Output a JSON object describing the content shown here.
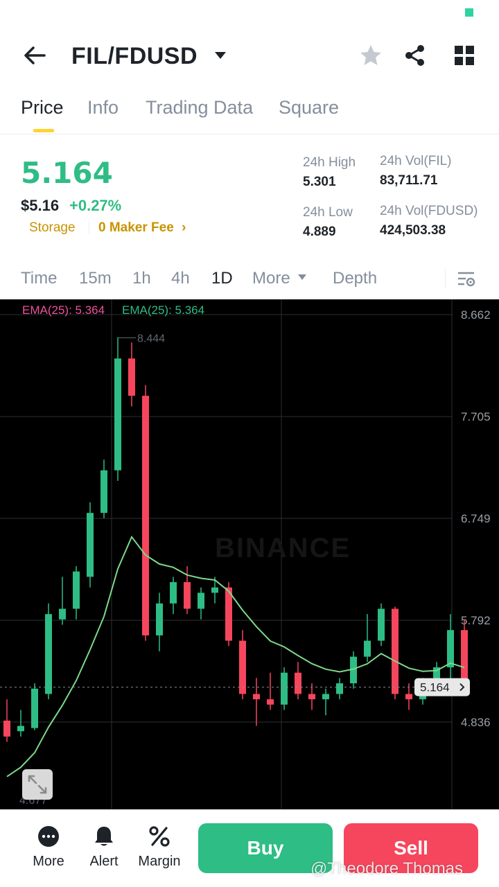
{
  "header": {
    "pair": "FIL/FDUSD",
    "icons": [
      "back-arrow-icon",
      "caret-down-icon",
      "star-icon",
      "share-icon",
      "grid-icon"
    ]
  },
  "tabs": [
    {
      "label": "Price",
      "active": true
    },
    {
      "label": "Info",
      "active": false
    },
    {
      "label": "Trading Data",
      "active": false
    },
    {
      "label": "Square",
      "active": false
    }
  ],
  "price": {
    "last": "5.164",
    "usd": "$5.16",
    "change": "+0.27%",
    "tag": "Storage",
    "fee": "0 Maker Fee",
    "fee_chevron": "›"
  },
  "stats": {
    "high_label": "24h High",
    "high": "5.301",
    "low_label": "24h Low",
    "low": "4.889",
    "vol_base_label": "24h Vol(FIL)",
    "vol_base": "83,711.71",
    "vol_quote_label": "24h Vol(FDUSD)",
    "vol_quote": "424,503.38"
  },
  "intervals": [
    {
      "label": "Time",
      "active": false
    },
    {
      "label": "15m",
      "active": false
    },
    {
      "label": "1h",
      "active": false
    },
    {
      "label": "4h",
      "active": false
    },
    {
      "label": "1D",
      "active": true
    },
    {
      "label": "More",
      "active": false
    },
    {
      "label": "Depth",
      "active": false
    }
  ],
  "chart_data": {
    "type": "candlestick",
    "ema_legend": [
      "EMA(25): 5.364",
      "EMA(25): 5.364"
    ],
    "y_ticks": [
      "8.662",
      "7.705",
      "6.749",
      "5.792",
      "4.836"
    ],
    "high_marker": "8.444",
    "low_marker": "4.677",
    "last_price_label": "5.164",
    "watermark": "BINANCE",
    "ylim": [
      4.6,
      8.9
    ],
    "colors": {
      "up": "#2ebd85",
      "down": "#f6465d",
      "ema": "#7ed98a",
      "background": "#000000"
    },
    "candles": [
      {
        "o": 4.85,
        "h": 5.05,
        "l": 4.65,
        "c": 4.7
      },
      {
        "o": 4.75,
        "h": 4.95,
        "l": 4.7,
        "c": 4.8
      },
      {
        "o": 4.78,
        "h": 5.2,
        "l": 4.76,
        "c": 5.15
      },
      {
        "o": 5.1,
        "h": 5.95,
        "l": 5.05,
        "c": 5.85
      },
      {
        "o": 5.8,
        "h": 6.2,
        "l": 5.75,
        "c": 5.9
      },
      {
        "o": 5.9,
        "h": 6.3,
        "l": 5.8,
        "c": 6.25
      },
      {
        "o": 6.2,
        "h": 6.9,
        "l": 6.1,
        "c": 6.8
      },
      {
        "o": 6.8,
        "h": 7.3,
        "l": 6.75,
        "c": 7.2
      },
      {
        "o": 7.2,
        "h": 8.45,
        "l": 7.1,
        "c": 8.25
      },
      {
        "o": 8.25,
        "h": 8.4,
        "l": 7.8,
        "c": 7.9
      },
      {
        "o": 7.9,
        "h": 8.0,
        "l": 5.6,
        "c": 5.65
      },
      {
        "o": 5.65,
        "h": 6.05,
        "l": 5.5,
        "c": 5.95
      },
      {
        "o": 5.95,
        "h": 6.2,
        "l": 5.85,
        "c": 6.15
      },
      {
        "o": 6.15,
        "h": 6.3,
        "l": 5.85,
        "c": 5.9
      },
      {
        "o": 5.9,
        "h": 6.1,
        "l": 5.8,
        "c": 6.05
      },
      {
        "o": 6.05,
        "h": 6.2,
        "l": 5.95,
        "c": 6.1
      },
      {
        "o": 6.1,
        "h": 6.15,
        "l": 5.55,
        "c": 5.6
      },
      {
        "o": 5.6,
        "h": 5.7,
        "l": 5.05,
        "c": 5.1
      },
      {
        "o": 5.1,
        "h": 5.25,
        "l": 4.8,
        "c": 5.05
      },
      {
        "o": 5.05,
        "h": 5.3,
        "l": 4.95,
        "c": 5.0
      },
      {
        "o": 5.0,
        "h": 5.35,
        "l": 4.95,
        "c": 5.3
      },
      {
        "o": 5.3,
        "h": 5.4,
        "l": 5.05,
        "c": 5.1
      },
      {
        "o": 5.1,
        "h": 5.2,
        "l": 4.95,
        "c": 5.05
      },
      {
        "o": 5.05,
        "h": 5.15,
        "l": 4.9,
        "c": 5.1
      },
      {
        "o": 5.1,
        "h": 5.25,
        "l": 5.05,
        "c": 5.2
      },
      {
        "o": 5.2,
        "h": 5.5,
        "l": 5.15,
        "c": 5.45
      },
      {
        "o": 5.45,
        "h": 5.85,
        "l": 5.4,
        "c": 5.6
      },
      {
        "o": 5.6,
        "h": 5.95,
        "l": 5.55,
        "c": 5.9
      },
      {
        "o": 5.9,
        "h": 5.92,
        "l": 5.05,
        "c": 5.1
      },
      {
        "o": 5.1,
        "h": 5.2,
        "l": 4.95,
        "c": 5.05
      },
      {
        "o": 5.05,
        "h": 5.25,
        "l": 5.0,
        "c": 5.18
      },
      {
        "o": 5.18,
        "h": 5.4,
        "l": 5.1,
        "c": 5.35
      },
      {
        "o": 5.35,
        "h": 5.85,
        "l": 5.2,
        "c": 5.7
      },
      {
        "o": 5.7,
        "h": 5.8,
        "l": 5.1,
        "c": 5.164
      }
    ]
  },
  "bottom_bar": {
    "more": "More",
    "alert": "Alert",
    "margin": "Margin",
    "buy": "Buy",
    "sell": "Sell",
    "watermark": "@Theodore Thomas"
  }
}
